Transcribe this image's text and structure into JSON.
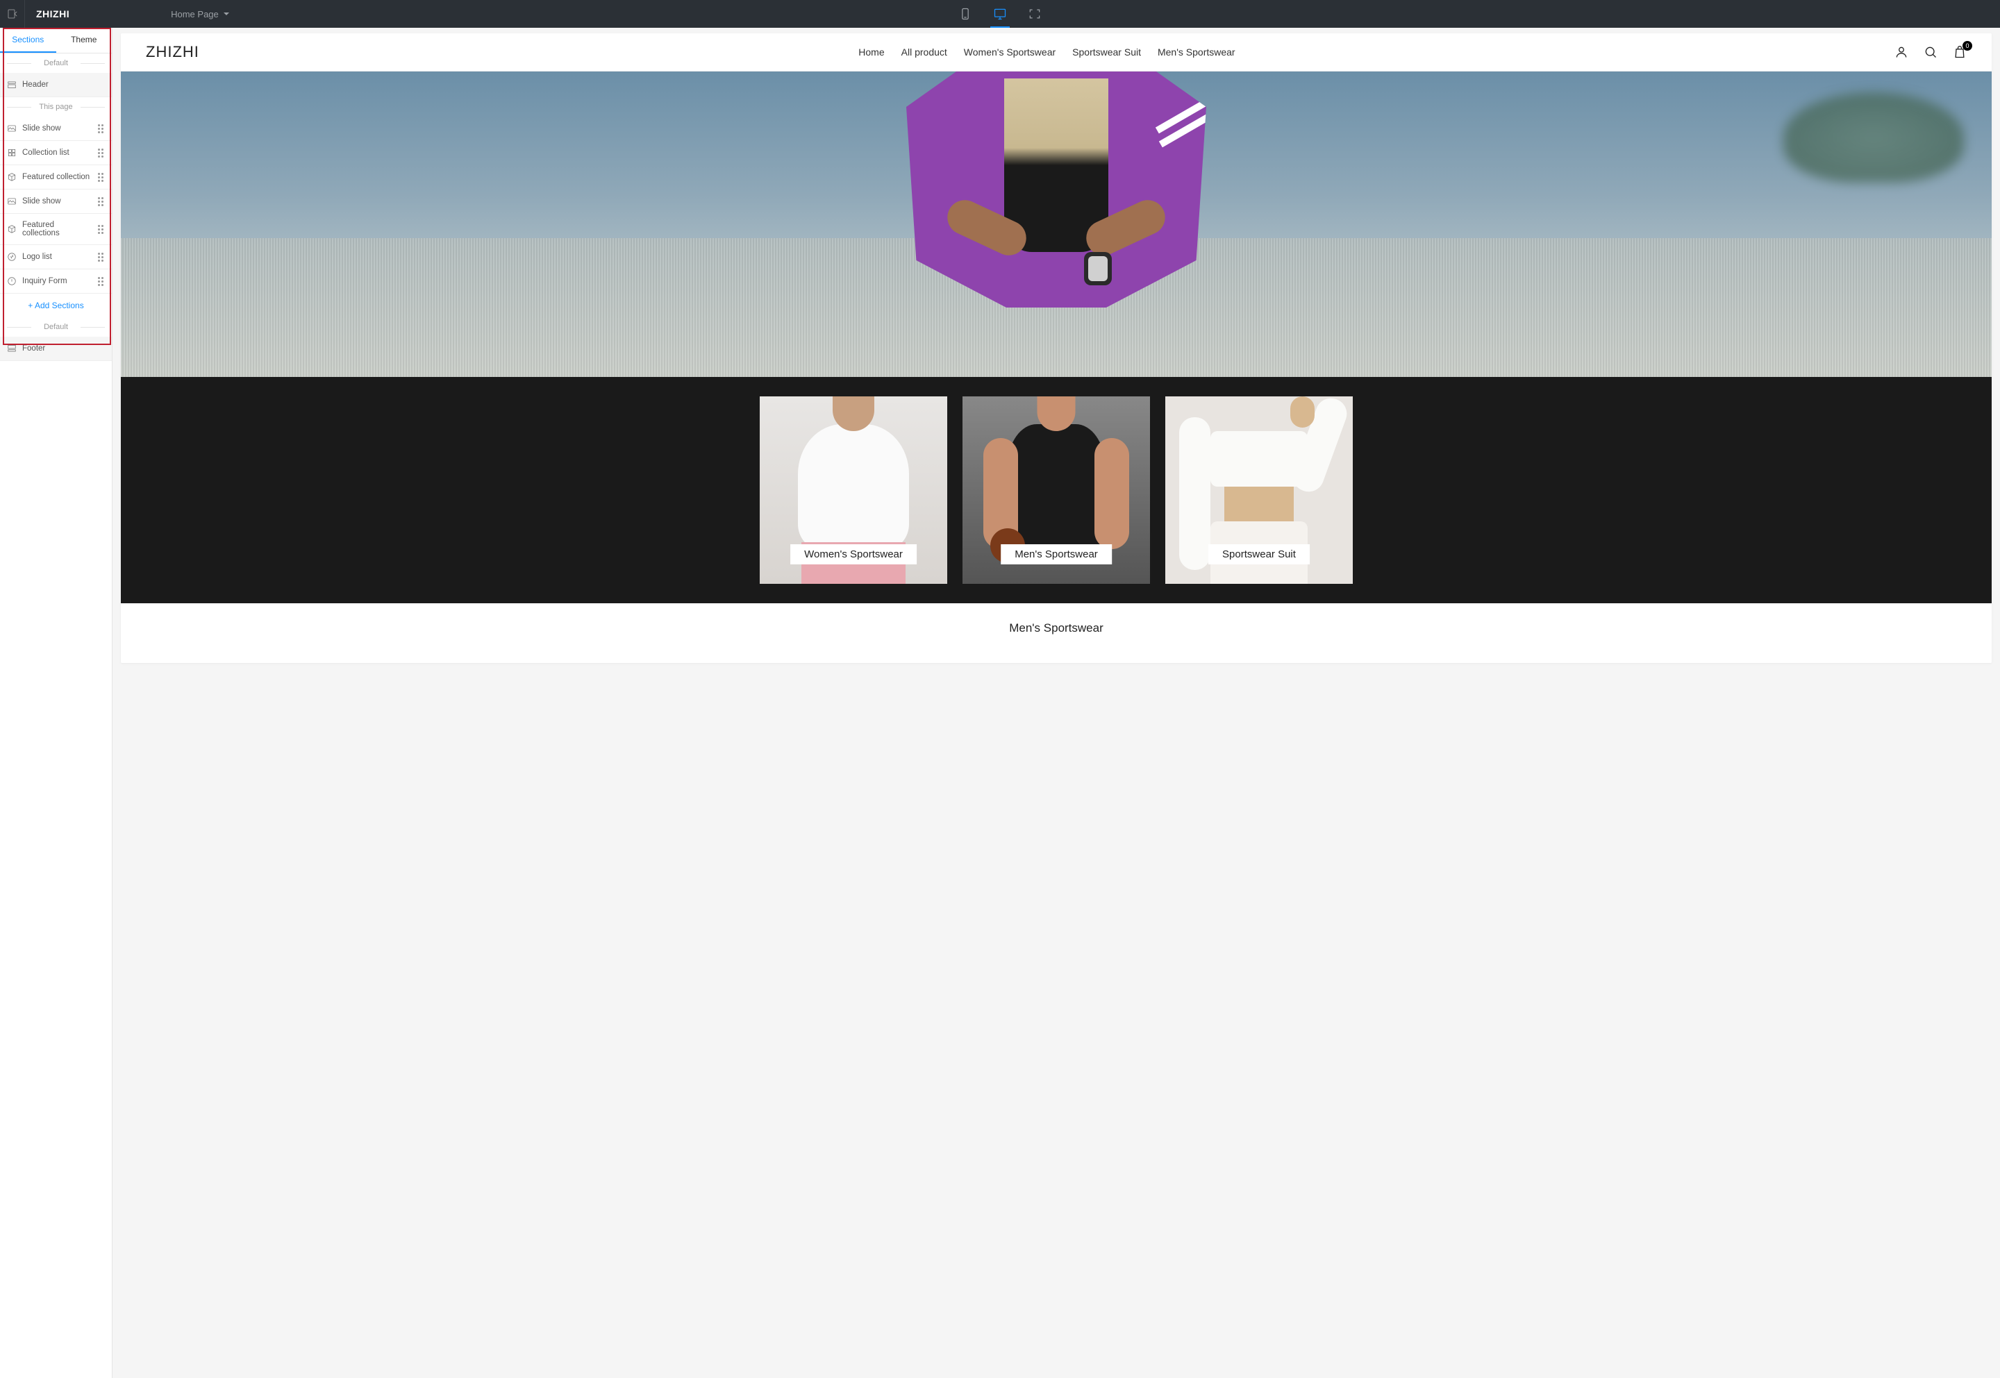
{
  "topbar": {
    "brand": "ZHIZHI",
    "page_selector": "Home Page"
  },
  "sidebar": {
    "tabs": {
      "sections": "Sections",
      "theme": "Theme"
    },
    "groups": {
      "default": "Default",
      "this_page": "This page"
    },
    "header_item": "Header",
    "footer_item": "Footer",
    "items": [
      {
        "label": "Slide show",
        "icon": "image"
      },
      {
        "label": "Collection list",
        "icon": "grid"
      },
      {
        "label": "Featured collection",
        "icon": "box"
      },
      {
        "label": "Slide show",
        "icon": "image"
      },
      {
        "label": "Featured collections",
        "icon": "box"
      },
      {
        "label": "Logo list",
        "icon": "logo"
      },
      {
        "label": "Inquiry Form",
        "icon": "form"
      }
    ],
    "add": "+ Add Sections"
  },
  "site": {
    "logo": "ZHIZHI",
    "nav": [
      "Home",
      "All product",
      "Women's Sportswear",
      "Sportswear Suit",
      "Men's Sportswear"
    ],
    "cart_badge": "0",
    "collections": [
      {
        "label": "Women's Sportswear"
      },
      {
        "label": "Men's Sportswear"
      },
      {
        "label": "Sportswear Suit"
      }
    ],
    "section_heading": "Men's Sportswear"
  }
}
